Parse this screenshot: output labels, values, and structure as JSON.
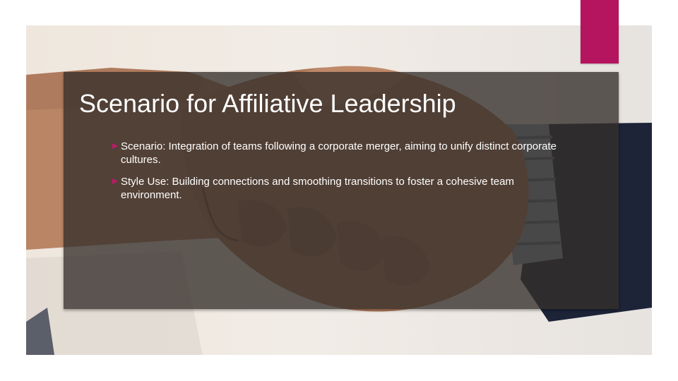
{
  "slide": {
    "title": "Scenario for Affiliative Leadership",
    "bullets": [
      {
        "text": "Scenario: Integration of teams following a corporate merger, aiming to unify distinct corporate cultures."
      },
      {
        "text": "Style Use: Building connections and smoothing transitions to foster a cohesive team environment."
      }
    ]
  },
  "icons": {
    "bullet": "triangle-right-icon"
  },
  "colors": {
    "accent": "#b5145f",
    "bullet": "#c0186a",
    "panel": "#342e2a",
    "text": "#ffffff",
    "background": "#ffffff"
  }
}
